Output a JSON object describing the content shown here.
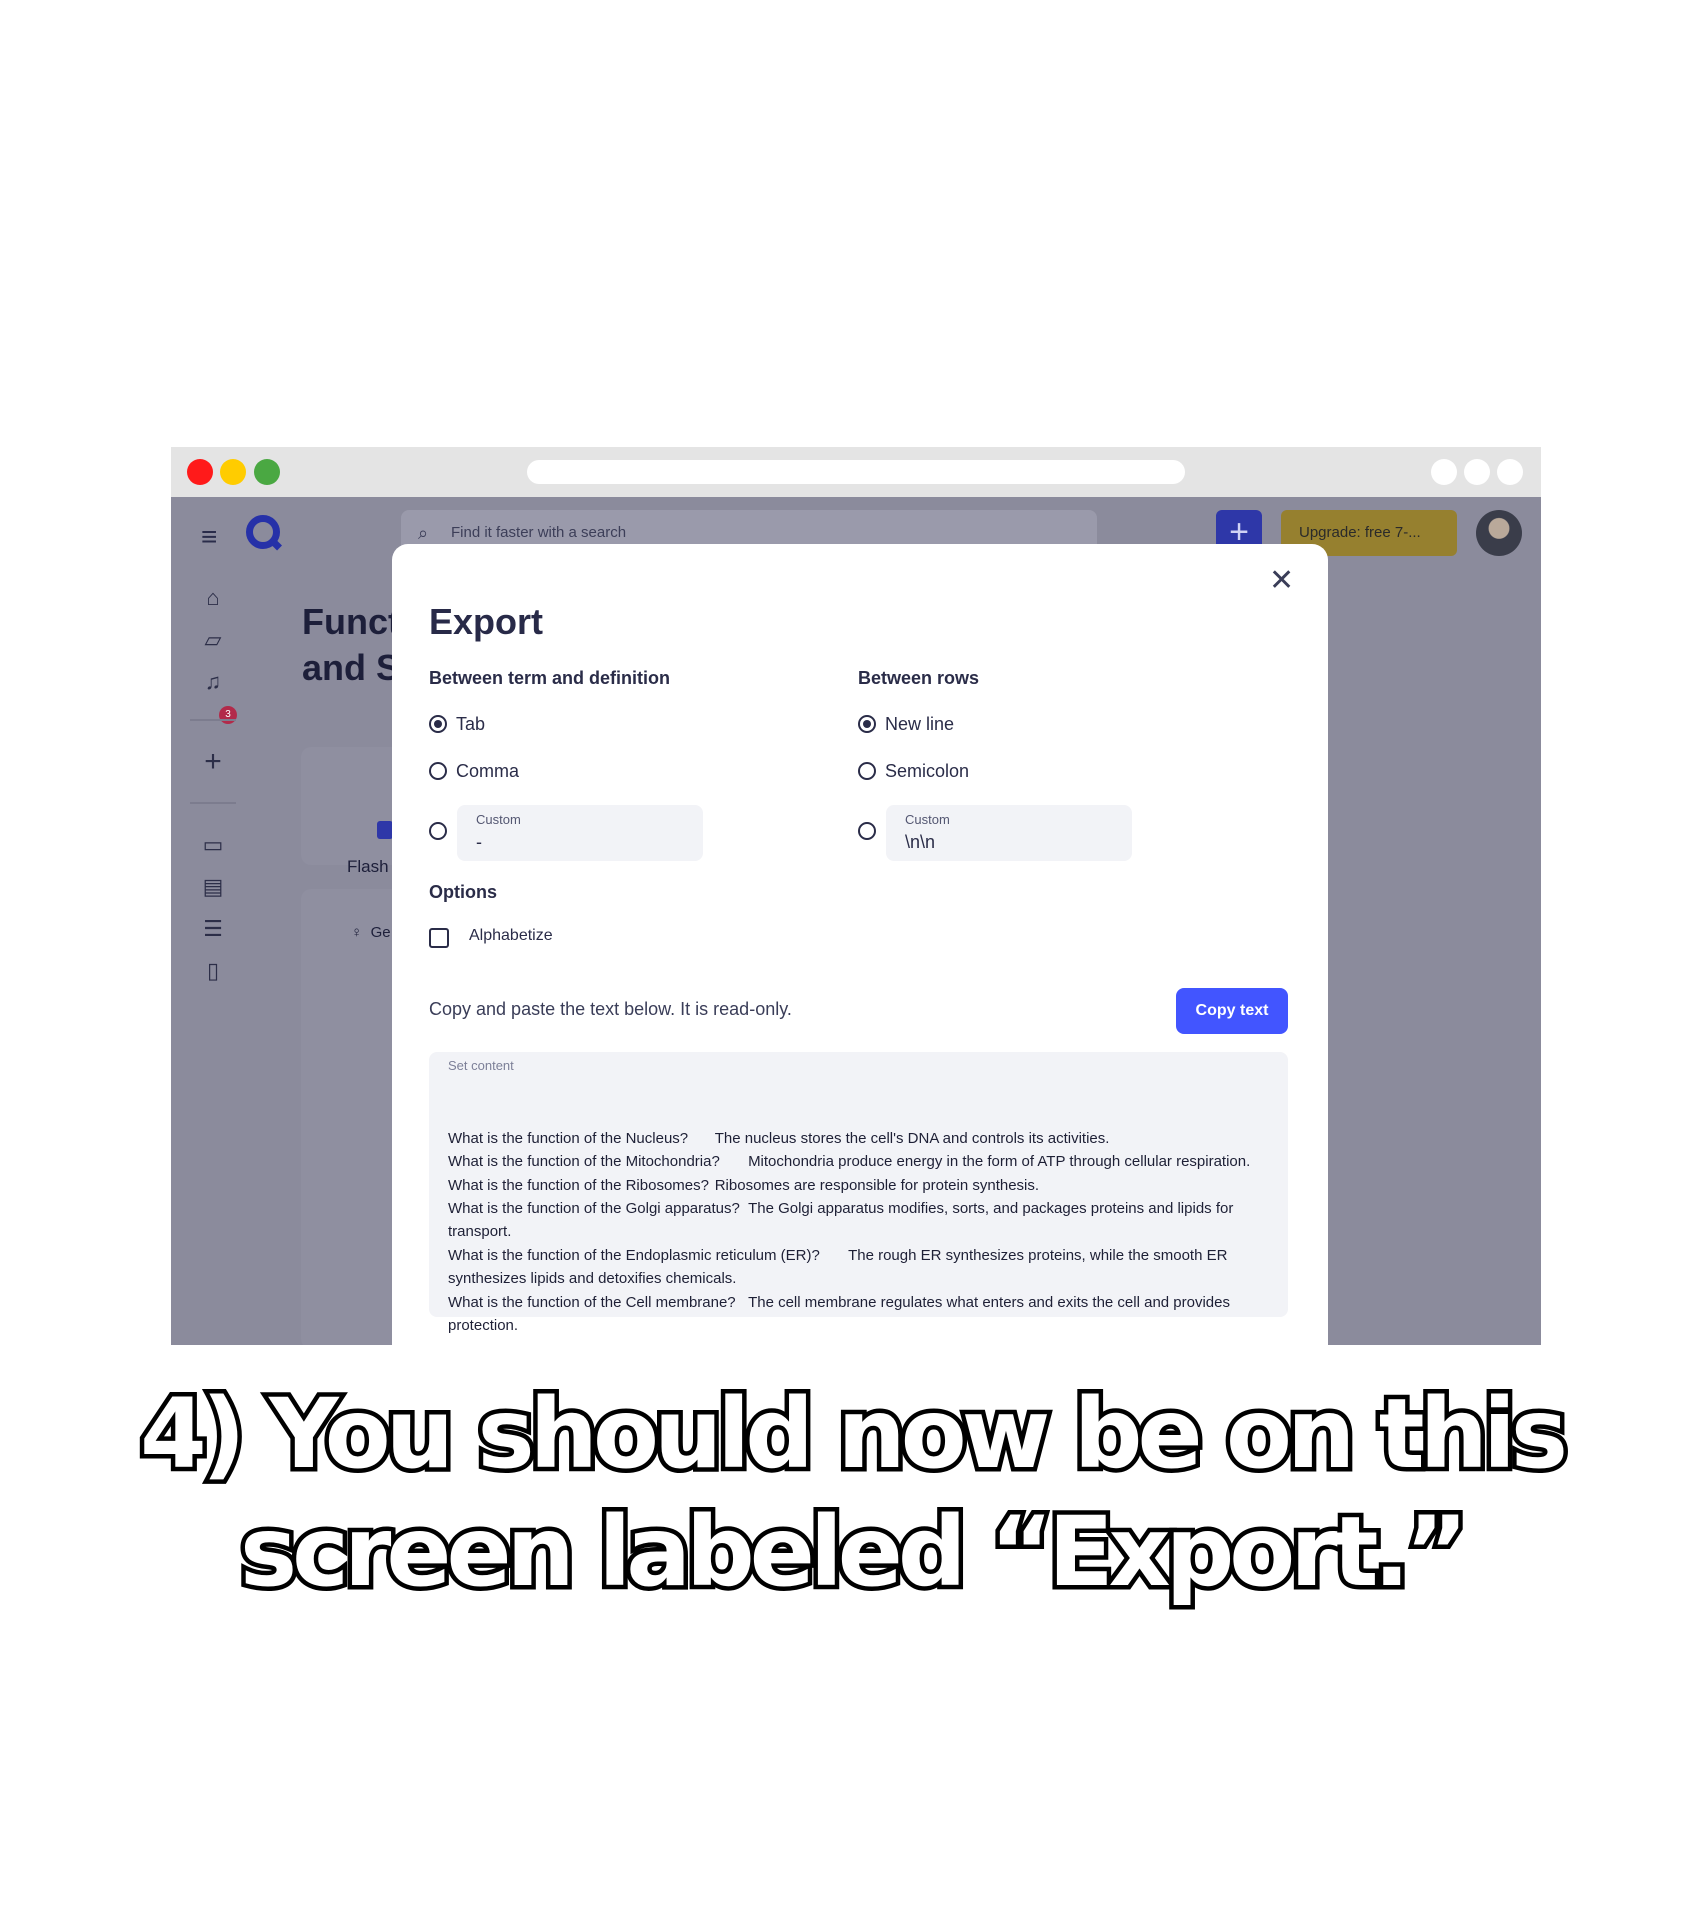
{
  "browser": {
    "url_placeholder": ""
  },
  "app": {
    "menu_icon": "≡",
    "search_placeholder": "Find it faster with a search",
    "create_label": "+",
    "upgrade_label": "Upgrade: free 7-...",
    "notification_count": "3",
    "bg_title_line1": "Funct",
    "bg_title_line2": "and S",
    "bg_card_label": "Flash",
    "bg_panel_text": "Ge"
  },
  "modal": {
    "title": "Export",
    "close_icon": "✕",
    "term_def": {
      "heading": "Between term and definition",
      "options": [
        "Tab",
        "Comma"
      ],
      "selected": "Tab",
      "custom_label": "Custom",
      "custom_value": "-"
    },
    "rows": {
      "heading": "Between rows",
      "options": [
        "New line",
        "Semicolon"
      ],
      "selected": "New line",
      "custom_label": "Custom",
      "custom_value": "\\n\\n"
    },
    "options_heading": "Options",
    "alphabetize_label": "Alphabetize",
    "copy_note": "Copy and paste the text below. It is read-only.",
    "copy_button": "Copy text",
    "content_label": "Set content",
    "content_lines": [
      "What is the function of the Nucleus?\tThe nucleus stores the cell's DNA and controls its activities.",
      "What is the function of the Mitochondria?\tMitochondria produce energy in the form of ATP through cellular respiration.",
      "What is the function of the Ribosomes?\tRibosomes are responsible for protein synthesis.",
      "What is the function of the Golgi apparatus?\tThe Golgi apparatus modifies, sorts, and packages proteins and lipids for transport.",
      "What is the function of the Endoplasmic reticulum (ER)?\tThe rough ER synthesizes proteins, while the smooth ER synthesizes lipids and detoxifies chemicals.",
      "What is the function of the Cell membrane?\tThe cell membrane regulates what enters and exits the cell and provides protection."
    ]
  },
  "caption": {
    "line1": "4) You should now be on this",
    "line2": "screen labeled “Export.”"
  },
  "colors": {
    "accent": "#4255ff",
    "overlay": "#8b8b9c",
    "upgrade": "#96802f"
  }
}
